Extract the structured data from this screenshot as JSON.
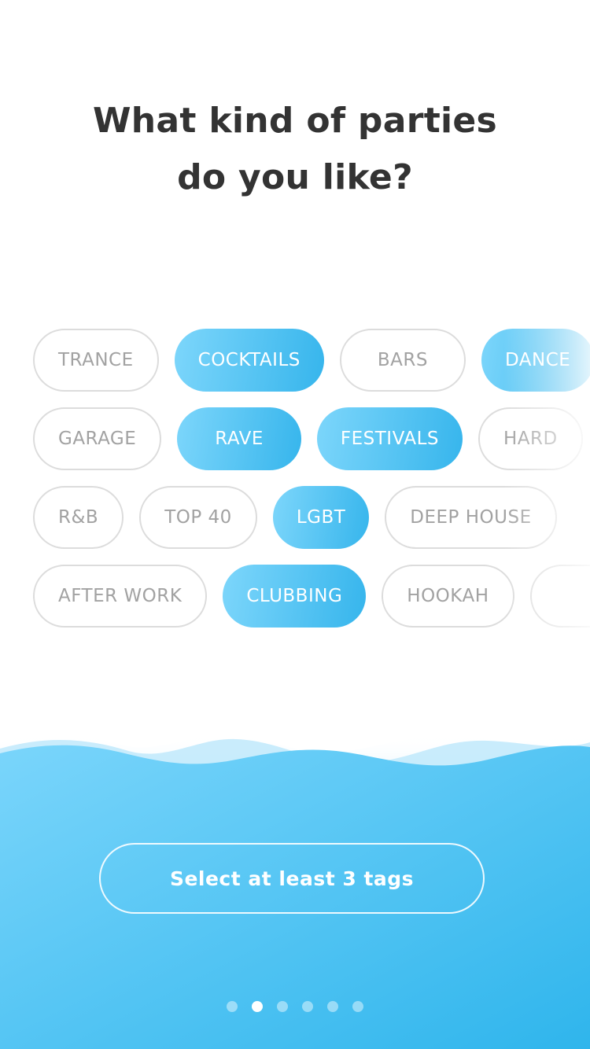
{
  "title": {
    "line1": "What kind of parties",
    "line2": "do you like?"
  },
  "tag_rows": [
    [
      {
        "label": "TRANCE",
        "selected": false
      },
      {
        "label": "COCKTAILS",
        "selected": true
      },
      {
        "label": "BARS",
        "selected": false
      },
      {
        "label": "DANCE",
        "selected": true
      }
    ],
    [
      {
        "label": "GARAGE",
        "selected": false
      },
      {
        "label": "RAVE",
        "selected": true
      },
      {
        "label": "FESTIVALS",
        "selected": true
      },
      {
        "label": "HARD",
        "selected": false
      }
    ],
    [
      {
        "label": "R&B",
        "selected": false
      },
      {
        "label": "TOP 40",
        "selected": false
      },
      {
        "label": "LGBT",
        "selected": true
      },
      {
        "label": "DEEP HOUSE",
        "selected": false
      }
    ],
    [
      {
        "label": "AFTER WORK",
        "selected": false
      },
      {
        "label": "CLUBBING",
        "selected": true
      },
      {
        "label": "HOOKAH",
        "selected": false
      },
      {
        "label": "",
        "selected": false
      }
    ]
  ],
  "cta": {
    "label": "Select at least 3 tags"
  },
  "pagination": {
    "total": 6,
    "active_index": 1
  },
  "colors": {
    "accent_start": "#7dd6fb",
    "accent_end": "#36b5ec",
    "title": "#333333",
    "tag_text": "#a2a2a2",
    "tag_border": "#dcdcdc"
  }
}
